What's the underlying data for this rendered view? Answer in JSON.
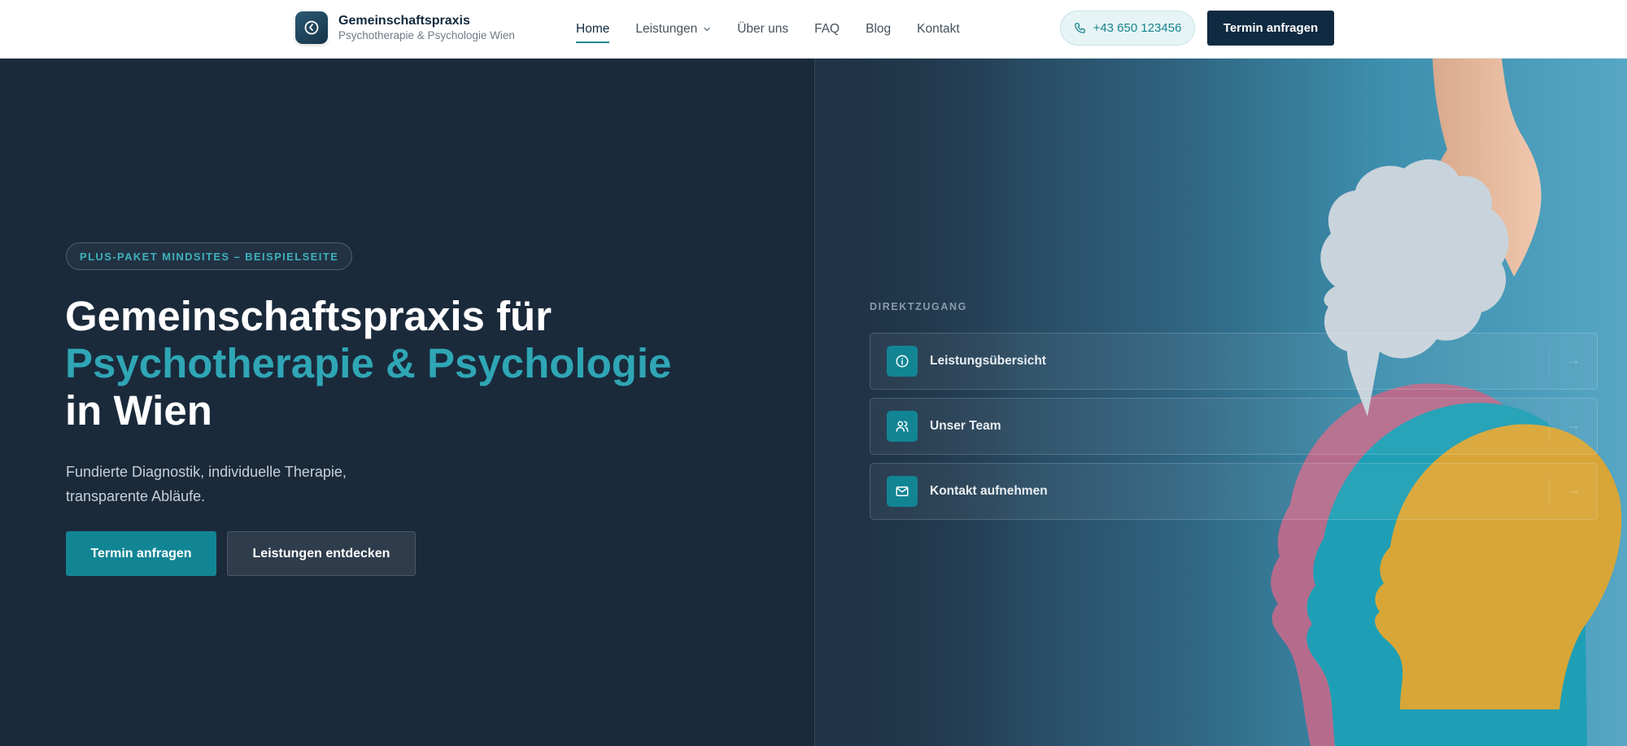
{
  "brand": {
    "title": "Gemeinschaftspraxis",
    "subtitle": "Psychotherapie & Psychologie Wien",
    "icon": "clock-icon"
  },
  "nav": {
    "items": [
      {
        "label": "Home",
        "active": true
      },
      {
        "label": "Leistungen",
        "dropdown": true
      },
      {
        "label": "Über uns"
      },
      {
        "label": "FAQ"
      },
      {
        "label": "Blog"
      },
      {
        "label": "Kontakt"
      }
    ]
  },
  "header": {
    "phone": "+43 650 123456",
    "cta": "Termin anfragen"
  },
  "hero": {
    "badge": "PLUS-PAKET MINDSITES – BEISPIELSEITE",
    "title_line1": "Gemeinschaftspraxis für",
    "title_line2": "Psychotherapie & Psychologie",
    "title_line3": "in Wien",
    "lead_line1": "Fundierte Diagnostik, individuelle Therapie,",
    "lead_line2": "transparente Abläufe.",
    "btn_primary": "Termin anfragen",
    "btn_secondary": "Leistungen entdecken"
  },
  "direktzugang": {
    "label": "DIREKTZUGANG",
    "items": [
      {
        "label": "Leistungsübersicht",
        "icon": "info-icon",
        "arrow": "→"
      },
      {
        "label": "Unser Team",
        "icon": "users-icon",
        "arrow": "→"
      },
      {
        "label": "Kontakt aufnehmen",
        "icon": "mail-icon",
        "arrow": "→"
      }
    ]
  },
  "colors": {
    "navy": "#102a41",
    "hero_bg": "#1a2a3b",
    "accent": "#2fa6b5",
    "button_teal": "#128594"
  }
}
